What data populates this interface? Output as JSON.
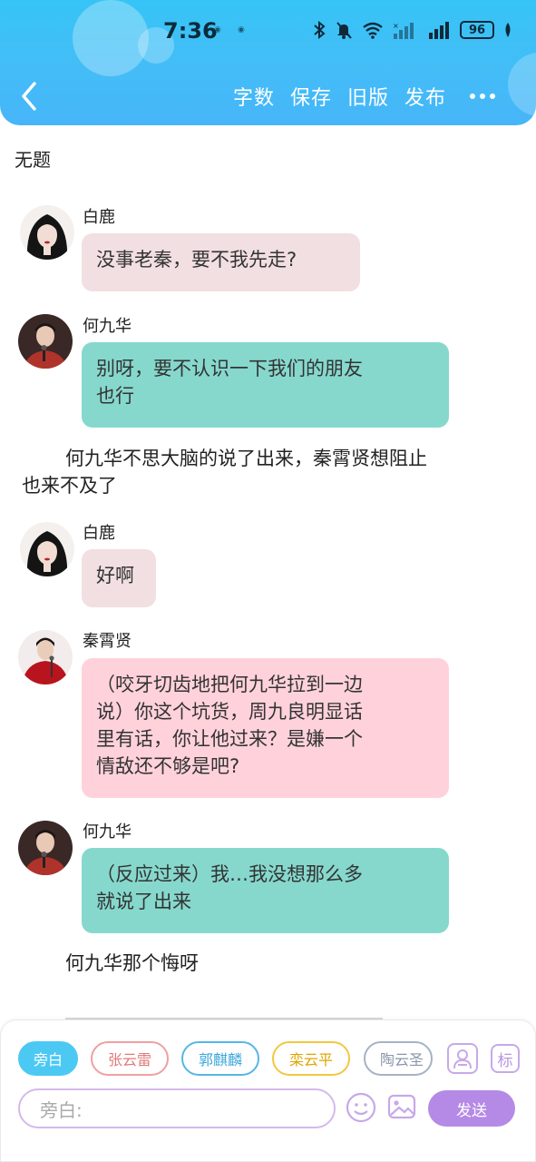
{
  "status_bar": {
    "time": "7:36",
    "battery": "96",
    "network_label": "4G"
  },
  "toolbar": {
    "word_count": "字数",
    "save": "保存",
    "old_version": "旧版",
    "publish": "发布"
  },
  "doc": {
    "title": "无题"
  },
  "messages": [
    {
      "speaker": "白鹿",
      "text": "没事老秦，要不我先走?"
    },
    {
      "speaker": "何九华",
      "lines": [
        "别呀，要不认识一下我们的朋友",
        "也行"
      ]
    },
    {
      "narration": [
        "何九华不思大脑的说了出来，秦霄贤想阻止",
        "也来不及了"
      ]
    },
    {
      "speaker": "白鹿",
      "text": "好啊"
    },
    {
      "speaker": "秦霄贤",
      "lines": [
        "（咬牙切齿地把何九华拉到一边",
        "说）你这个坑货，周九良明显话",
        "里有话，你让他过来？是嫌一个",
        "情敌还不够是吧?"
      ]
    },
    {
      "speaker": "何九华",
      "lines": [
        "（反应过来）我…我没想那么多",
        "就说了出来"
      ]
    },
    {
      "narration": [
        "何九华那个悔呀"
      ]
    }
  ],
  "composer": {
    "chips": [
      "旁白",
      "张云雷",
      "郭麒麟",
      "栾云平",
      "陶云圣"
    ],
    "role_icon_label": "标",
    "input_placeholder": "旁白:",
    "send_label": "发送"
  },
  "colors": {
    "header": "#3fbdf7",
    "bubble_pink_light": "#f2dfe1",
    "bubble_teal": "#86d8cd",
    "bubble_pink": "#ffd2db",
    "send": "#b58ae6"
  }
}
